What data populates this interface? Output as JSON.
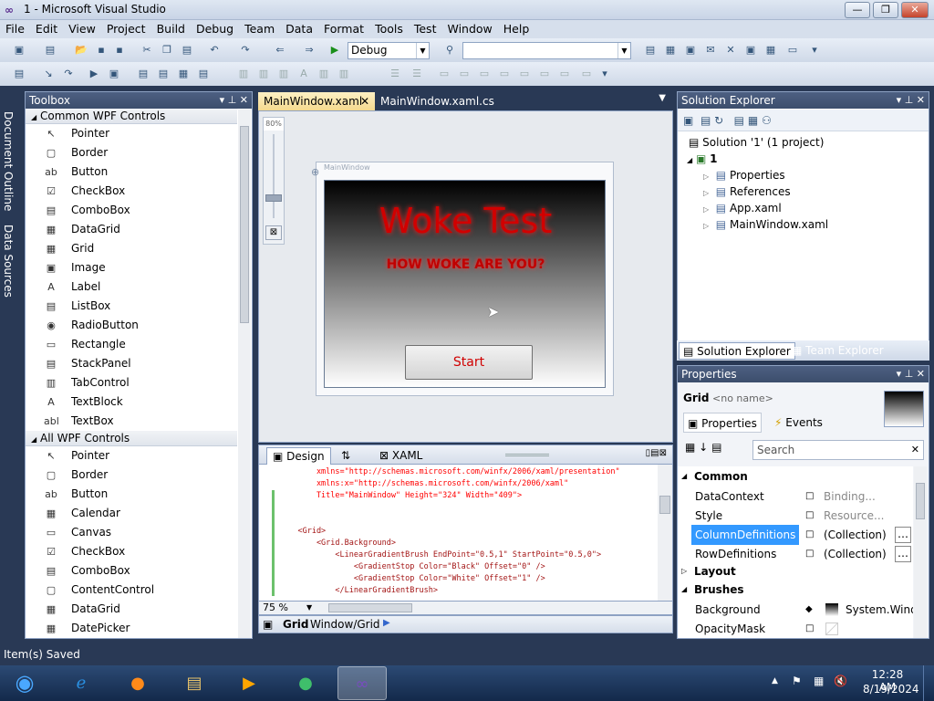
{
  "window": {
    "title": "1 - Microsoft Visual Studio",
    "logo": "∞",
    "minimize": "—",
    "maximize": "❐",
    "close": "✕"
  },
  "menu": [
    "File",
    "Edit",
    "View",
    "Project",
    "Build",
    "Debug",
    "Team",
    "Data",
    "Format",
    "Tools",
    "Test",
    "Window",
    "Help"
  ],
  "toolbar": {
    "config": "Debug",
    "platform": ""
  },
  "leftstrip": {
    "doc_outline": "Document Outline",
    "data_sources": "Data Sources"
  },
  "toolbox": {
    "title": "Toolbox",
    "groups": [
      {
        "name": "Common WPF Controls",
        "items": [
          {
            "icon": "↖",
            "label": "Pointer"
          },
          {
            "icon": "▢",
            "label": "Border"
          },
          {
            "icon": "ab",
            "label": "Button"
          },
          {
            "icon": "☑",
            "label": "CheckBox"
          },
          {
            "icon": "▤",
            "label": "ComboBox"
          },
          {
            "icon": "▦",
            "label": "DataGrid"
          },
          {
            "icon": "▦",
            "label": "Grid"
          },
          {
            "icon": "▣",
            "label": "Image"
          },
          {
            "icon": "A",
            "label": "Label"
          },
          {
            "icon": "▤",
            "label": "ListBox"
          },
          {
            "icon": "◉",
            "label": "RadioButton"
          },
          {
            "icon": "▭",
            "label": "Rectangle"
          },
          {
            "icon": "▤",
            "label": "StackPanel"
          },
          {
            "icon": "▥",
            "label": "TabControl"
          },
          {
            "icon": "A",
            "label": "TextBlock"
          },
          {
            "icon": "abl",
            "label": "TextBox"
          }
        ]
      },
      {
        "name": "All WPF Controls",
        "items": [
          {
            "icon": "↖",
            "label": "Pointer"
          },
          {
            "icon": "▢",
            "label": "Border"
          },
          {
            "icon": "ab",
            "label": "Button"
          },
          {
            "icon": "▦",
            "label": "Calendar"
          },
          {
            "icon": "▭",
            "label": "Canvas"
          },
          {
            "icon": "☑",
            "label": "CheckBox"
          },
          {
            "icon": "▤",
            "label": "ComboBox"
          },
          {
            "icon": "▢",
            "label": "ContentControl"
          },
          {
            "icon": "▦",
            "label": "DataGrid"
          },
          {
            "icon": "▦",
            "label": "DatePicker"
          }
        ]
      }
    ]
  },
  "doctabs": {
    "active": "MainWindow.xaml",
    "other": "MainWindow.xaml.cs"
  },
  "designer": {
    "zoom": "80%",
    "window_label": "MainWindow",
    "title": "Woke Test",
    "subtitle": "HOW WOKE ARE YOU?",
    "button": "Start"
  },
  "split": {
    "design": "Design",
    "swap": "⇅",
    "xaml": "XAML"
  },
  "xaml_lines": [
    {
      "t": "        xmlns=\"http://schemas.microsoft.com/winfx/2006/xaml/presentation\""
    },
    {
      "t": "        xmlns:x=\"http://schemas.microsoft.com/winfx/2006/xaml\""
    },
    {
      "t": "        Title=\"MainWindow\" Height=\"324\" Width=\"409\">"
    },
    {
      "t": ""
    },
    {
      "t": ""
    },
    {
      "t": "    <Grid>"
    },
    {
      "t": "        <Grid.Background>"
    },
    {
      "t": "            <LinearGradientBrush EndPoint=\"0.5,1\" StartPoint=\"0.5,0\">"
    },
    {
      "t": "                <GradientStop Color=\"Black\" Offset=\"0\" />"
    },
    {
      "t": "                <GradientStop Color=\"White\" Offset=\"1\" />"
    },
    {
      "t": "            </LinearGradientBrush>"
    }
  ],
  "xaml_zoom": "75 %",
  "breadcrumb": {
    "element": "Grid",
    "path": "Window/Grid"
  },
  "solution_explorer": {
    "title": "Solution Explorer",
    "solution": "Solution '1' (1 project)",
    "project": "1",
    "items": [
      "Properties",
      "References",
      "App.xaml",
      "MainWindow.xaml"
    ],
    "tab1": "Solution Explorer",
    "tab2": "Team Explorer"
  },
  "properties": {
    "title": "Properties",
    "element": "Grid",
    "name": "<no name>",
    "tab_props": "Properties",
    "tab_events": "Events",
    "search_placeholder": "Search",
    "categories": [
      {
        "name": "Common",
        "rows": [
          {
            "n": "DataContext",
            "v": "Binding...",
            "sel": false
          },
          {
            "n": "Style",
            "v": "Resource...",
            "sel": false
          },
          {
            "n": "ColumnDefinitions",
            "v": "(Collection)",
            "sel": true
          },
          {
            "n": "RowDefinitions",
            "v": "(Collection)",
            "sel": false
          }
        ]
      },
      {
        "name": "Layout",
        "rows": []
      },
      {
        "name": "Brushes",
        "rows": [
          {
            "n": "Background",
            "v": "System.Wind",
            "sel": false
          },
          {
            "n": "OpacityMask",
            "v": "",
            "sel": false
          }
        ]
      }
    ]
  },
  "status": "Item(s) Saved",
  "taskbar": {
    "time": "12:28 AM",
    "date": "8/19/2024"
  },
  "colors": {
    "vs_chrome": "#293955",
    "accent_tab": "#f5d98e",
    "title_red": "#d10000"
  }
}
